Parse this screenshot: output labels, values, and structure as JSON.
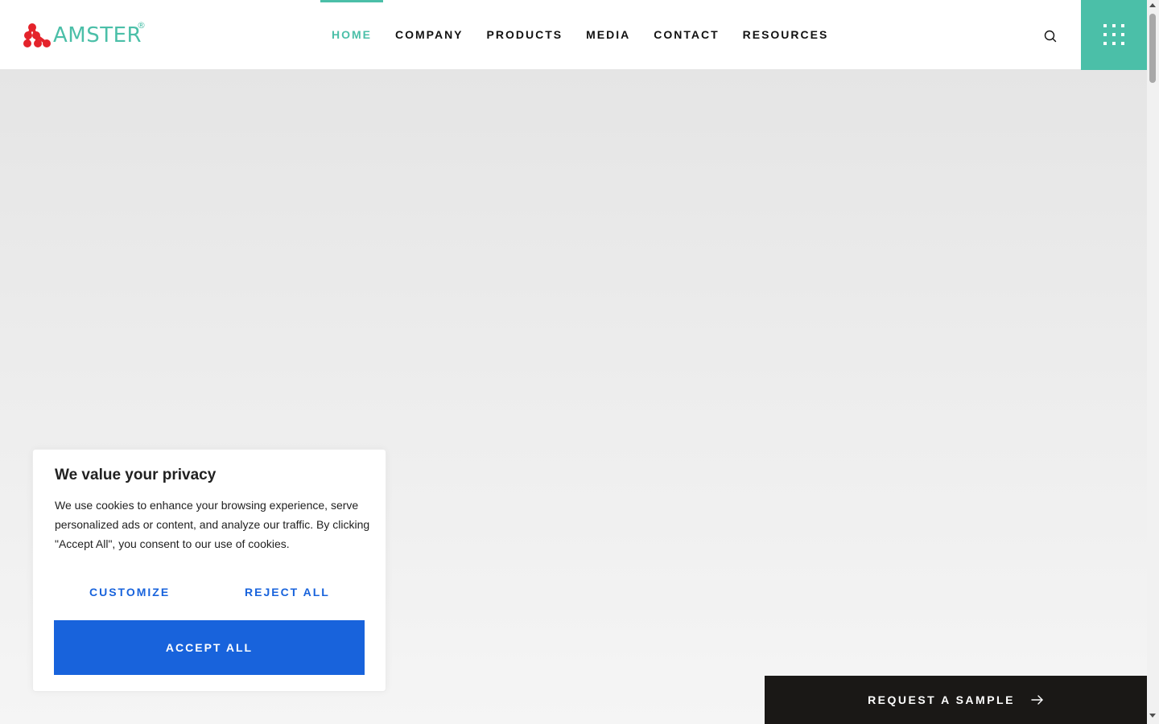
{
  "header": {
    "logo": {
      "text": "AMSTER",
      "registered": "®",
      "icon": "amster-logo-icon"
    },
    "nav": [
      {
        "label": "HOME",
        "active": true
      },
      {
        "label": "COMPANY",
        "active": false
      },
      {
        "label": "PRODUCTS",
        "active": false
      },
      {
        "label": "MEDIA",
        "active": false
      },
      {
        "label": "CONTACT",
        "active": false
      },
      {
        "label": "RESOURCES",
        "active": false
      }
    ],
    "search_icon": "search-icon",
    "menu_icon": "grid-dots-icon"
  },
  "cookie_banner": {
    "title": "We value your privacy",
    "text": "We use cookies to enhance your browsing experience, serve personalized ads or content, and analyze our traffic. By clicking \"Accept All\", you consent to our use of cookies.",
    "customize_label": "CUSTOMIZE",
    "reject_label": "REJECT ALL",
    "accept_label": "ACCEPT ALL"
  },
  "cta": {
    "label": "REQUEST A SAMPLE",
    "icon": "arrow-right-icon"
  },
  "colors": {
    "brand": "#4bbfa8",
    "logo_red": "#e4232b",
    "primary_button": "#1863dc",
    "cta_background": "#1a1816"
  }
}
